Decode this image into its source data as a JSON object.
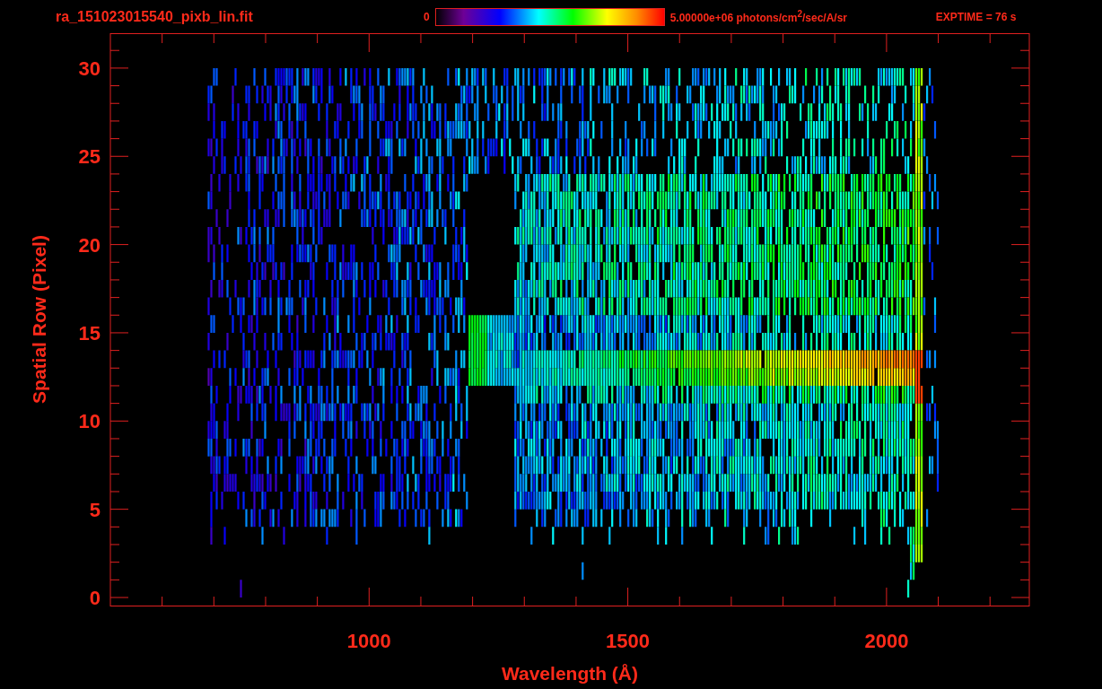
{
  "header": {
    "filename": "ra_151023015540_pixb_lin.fit",
    "colorbar": {
      "min_label": "0",
      "max_label": "5.00000e+06 photons/cm$^{2}$/sec/A/sr"
    },
    "exposure": "EXPTIME = 76 s"
  },
  "plot": {
    "xlabel": "Wavelength (Å)",
    "ylabel": "Spatial Row (Pixel)",
    "xticks": [
      "1000",
      "1500",
      "2000"
    ],
    "yticks": [
      "30",
      "25",
      "20",
      "15",
      "10",
      "5",
      "0"
    ]
  }
}
